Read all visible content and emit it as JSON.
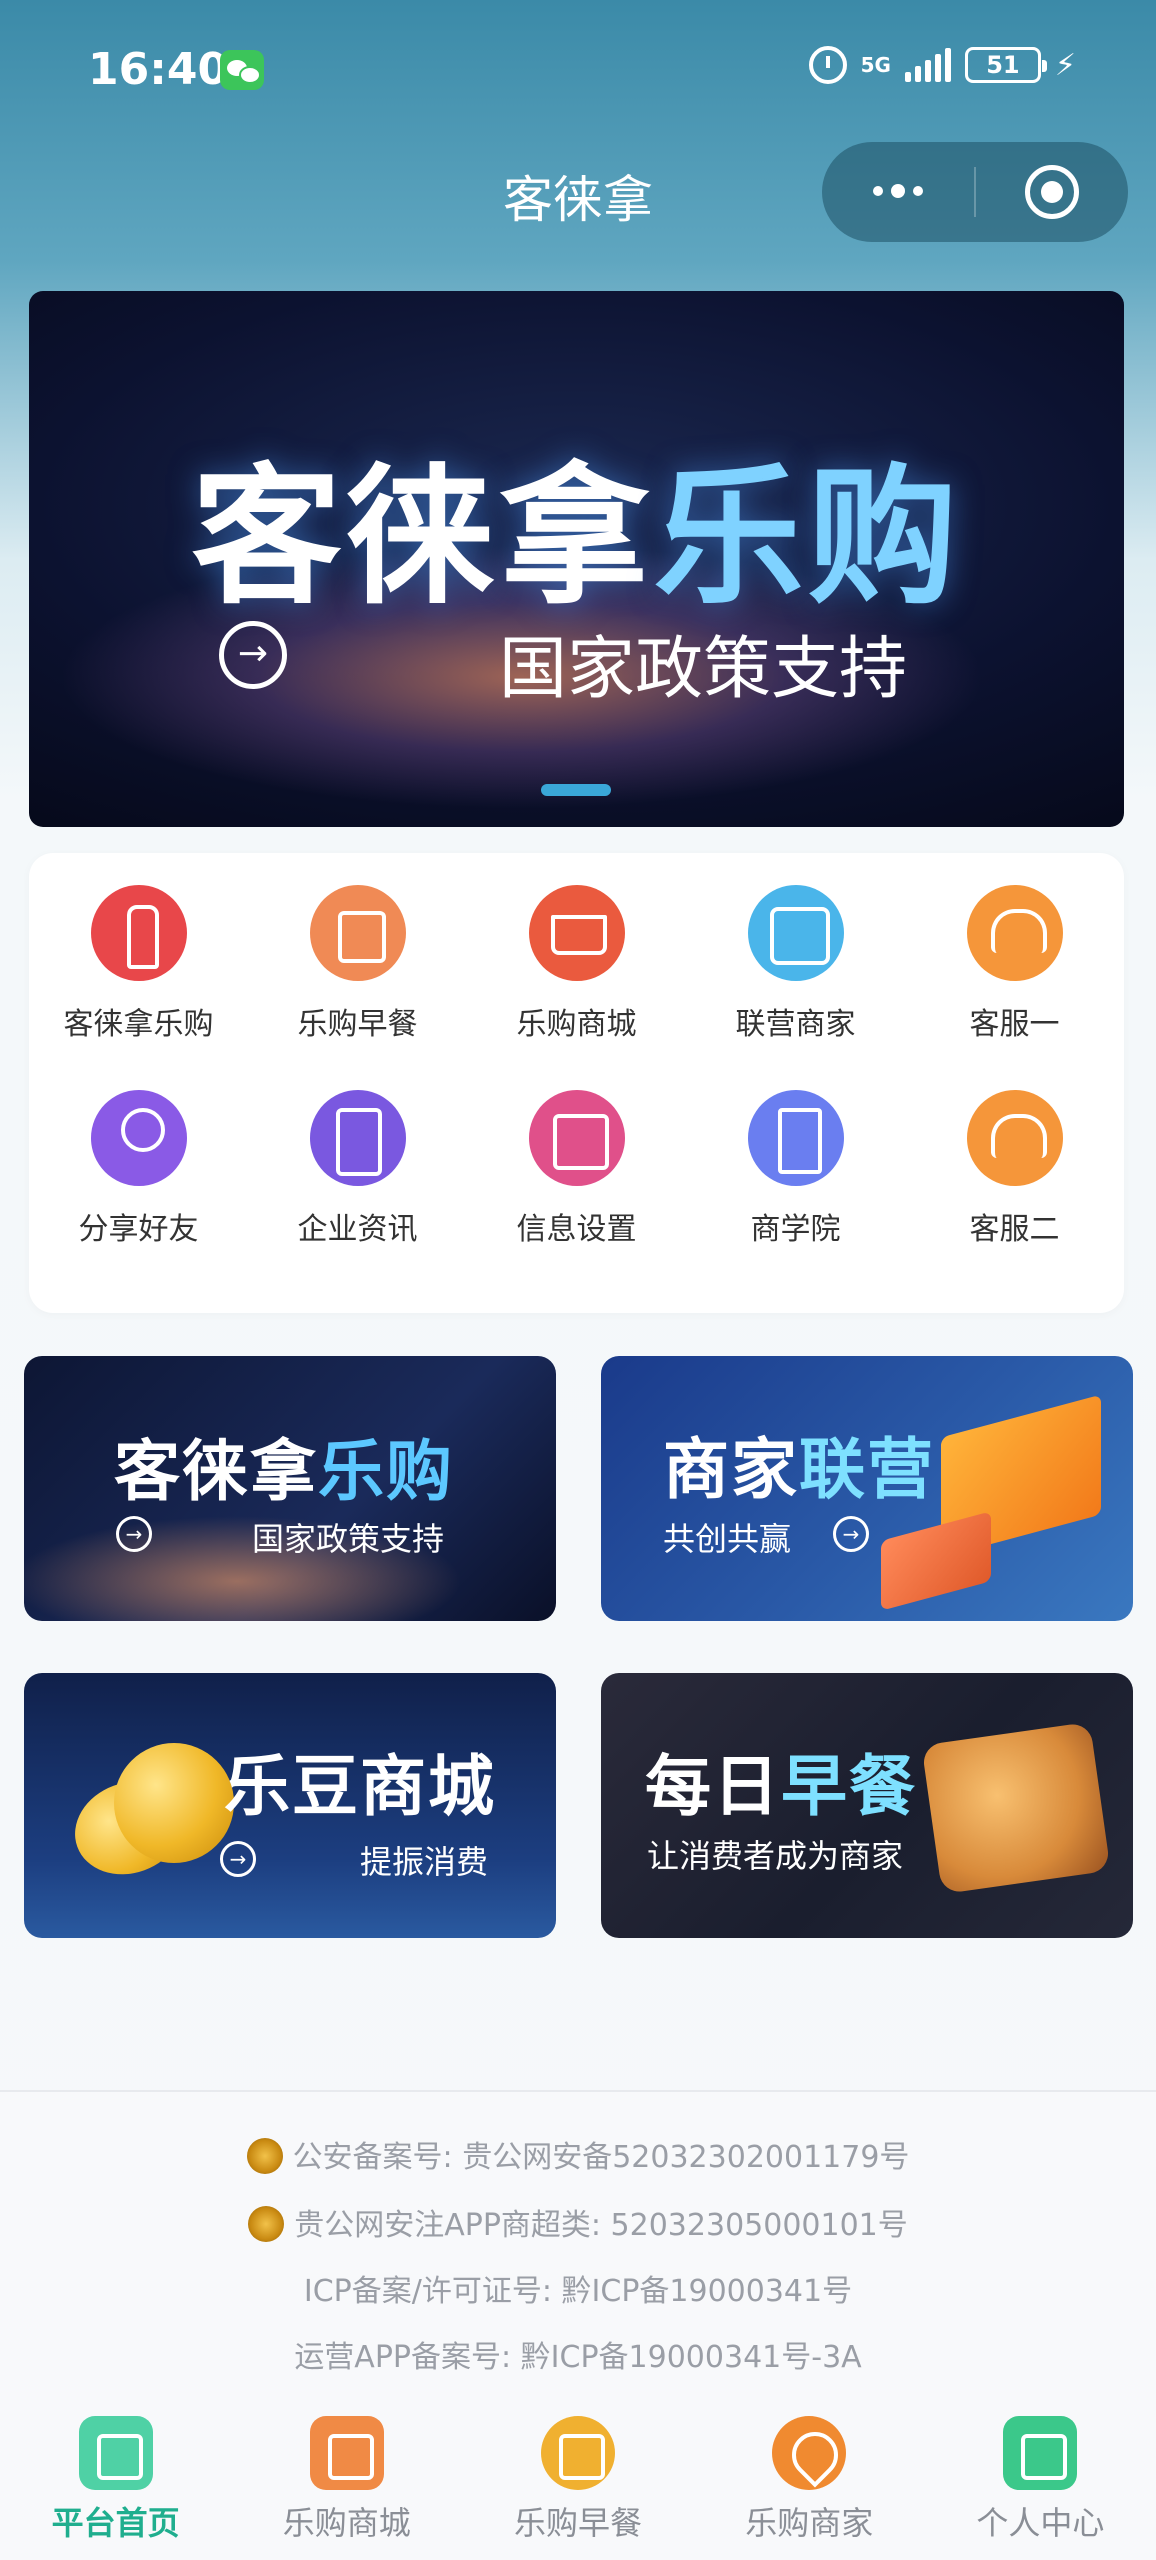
{
  "status_bar": {
    "time": "16:40",
    "network": "5G",
    "battery": "51"
  },
  "header": {
    "title": "客徕拿"
  },
  "banner": {
    "title_part1": "客徕拿",
    "title_part2": "乐购",
    "subtitle": "国家政策支持"
  },
  "grid": {
    "items": [
      {
        "label": "客徕拿乐购",
        "color": "#e8474a"
      },
      {
        "label": "乐购早餐",
        "color": "#f08a55"
      },
      {
        "label": "乐购商城",
        "color": "#ea5a3e"
      },
      {
        "label": "联营商家",
        "color": "#4ab5ea"
      },
      {
        "label": "客服一",
        "color": "#f5963a"
      },
      {
        "label": "分享好友",
        "color": "#8a5ae6"
      },
      {
        "label": "企业资讯",
        "color": "#7a58e0"
      },
      {
        "label": "信息设置",
        "color": "#e0508a"
      },
      {
        "label": "商学院",
        "color": "#6a7ef0"
      },
      {
        "label": "客服二",
        "color": "#f5963a"
      }
    ]
  },
  "promos": [
    {
      "title_a": "客徕拿",
      "title_b": "乐购",
      "subtitle": "国家政策支持"
    },
    {
      "title_a": "商家",
      "title_b": "联营",
      "subtitle": "共创共赢"
    },
    {
      "title_a": "乐豆商城",
      "title_b": "",
      "subtitle": "提振消费"
    },
    {
      "title_a": "每日",
      "title_b": "早餐",
      "subtitle": "让消费者成为商家"
    }
  ],
  "footer": {
    "line1": "公安备案号: 贵公网安备52032302001179号",
    "line2": "贵公网安注APP商超类: 52032305000101号",
    "line3": "ICP备案/许可证号: 黔ICP备19000341号",
    "line4": "运营APP备案号: 黔ICP备19000341号-3A"
  },
  "tabbar": {
    "items": [
      {
        "label": "平台首页",
        "color": "#4fd1a5"
      },
      {
        "label": "乐购商城",
        "color": "#f08a45"
      },
      {
        "label": "乐购早餐",
        "color": "#f0b030"
      },
      {
        "label": "乐购商家",
        "color": "#f08a30"
      },
      {
        "label": "个人中心",
        "color": "#3bc88a"
      }
    ]
  }
}
